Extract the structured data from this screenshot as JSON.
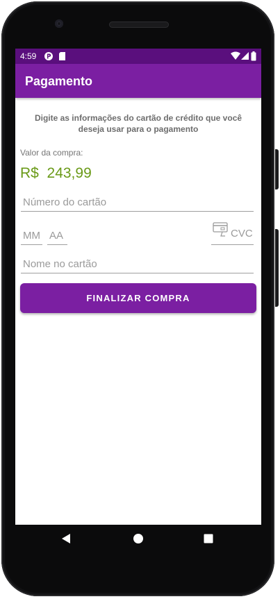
{
  "status_bar": {
    "time": "4:59",
    "icons": [
      "app-notification-icon",
      "sd-card-icon",
      "wifi-icon",
      "signal-icon",
      "battery-icon"
    ]
  },
  "app_bar": {
    "title": "Pagamento"
  },
  "payment_form": {
    "instructions": "Digite as informações do cartão de crédito que você deseja usar para o pagamento",
    "amount_label": "Valor da compra:",
    "amount_value": "R$  243,99",
    "card_number_placeholder": "Número do cartão",
    "month_placeholder": "MM",
    "year_placeholder": "AA",
    "cvc_placeholder": "CVC",
    "card_name_placeholder": "Nome no cartão",
    "submit_label": "FINALIZAR COMPRA"
  },
  "navigation": {
    "buttons": [
      "back-icon",
      "home-icon",
      "recents-icon"
    ]
  },
  "colors": {
    "primary": "#7b1fa2",
    "primary_dark": "#5a0f7d",
    "amount": "#6a9a18",
    "hint": "#9a9a9a"
  }
}
